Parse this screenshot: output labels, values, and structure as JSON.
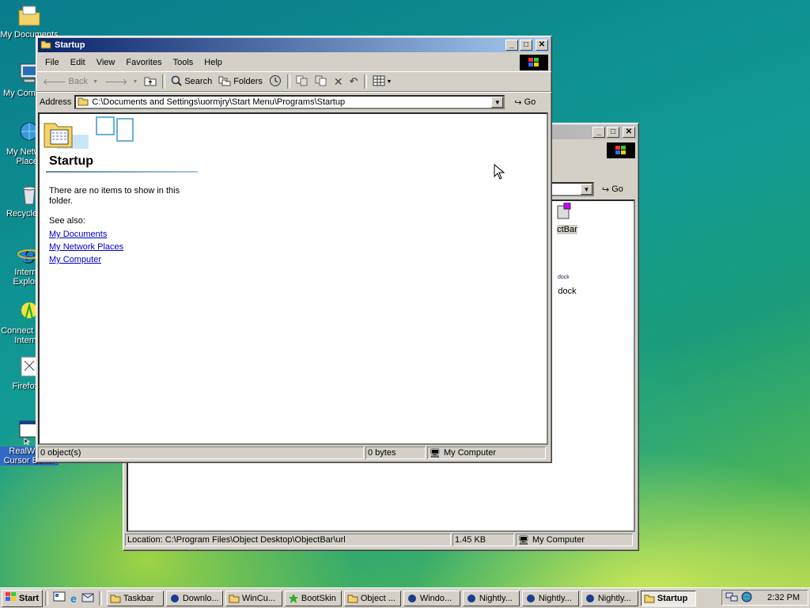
{
  "desktop": {
    "icons": [
      {
        "label": "My Documents"
      },
      {
        "label": "My Computer"
      },
      {
        "label": "My Network Places"
      },
      {
        "label": "Recycle Bin"
      },
      {
        "label": "Internet Explorer"
      },
      {
        "label": "Connect to the Internet"
      },
      {
        "label": "Firefox 4"
      },
      {
        "label": "RealWorld Cursor Editor"
      }
    ]
  },
  "back_window": {
    "address_go": "Go",
    "items": [
      {
        "label": "ctBar"
      },
      {
        "label": "dock"
      }
    ],
    "status": {
      "location": "Location: C:\\Program Files\\Object Desktop\\ObjectBar\\url",
      "size": "1.45 KB",
      "zone": "My Computer"
    }
  },
  "window": {
    "title": "Startup",
    "menu": [
      "File",
      "Edit",
      "View",
      "Favorites",
      "Tools",
      "Help"
    ],
    "toolbar": {
      "back": "Back",
      "search": "Search",
      "folders": "Folders"
    },
    "address": {
      "label": "Address",
      "value": "C:\\Documents and Settings\\uormjry\\Start Menu\\Programs\\Startup",
      "go": "Go"
    },
    "panel": {
      "folder_title": "Startup",
      "empty_message": "There are no items to show in this folder.",
      "see_also": "See also:",
      "links": [
        "My Documents",
        "My Network Places",
        "My Computer"
      ]
    },
    "status": {
      "objects": "0 object(s)",
      "size": "0 bytes",
      "zone": "My Computer"
    }
  },
  "taskbar": {
    "start": "Start",
    "tasks": [
      {
        "label": "Taskbar",
        "active": false
      },
      {
        "label": "Downlo...",
        "active": false
      },
      {
        "label": "WinCu...",
        "active": false
      },
      {
        "label": "BootSkin",
        "active": false
      },
      {
        "label": "Object ...",
        "active": false
      },
      {
        "label": "Windo...",
        "active": false
      },
      {
        "label": "Nightly...",
        "active": false
      },
      {
        "label": "Nightly...",
        "active": false
      },
      {
        "label": "Nightly...",
        "active": false
      },
      {
        "label": "Startup",
        "active": true
      }
    ],
    "clock": "2:32 PM"
  }
}
